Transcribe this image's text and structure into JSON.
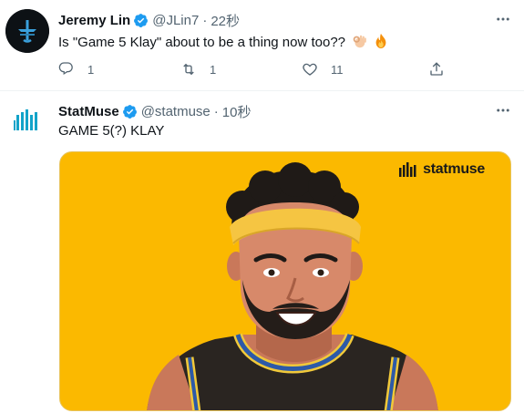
{
  "tweets": [
    {
      "name": "Jeremy Lin",
      "handle": "@JLin7",
      "separator": "·",
      "time": "22秒",
      "text": "Is \"Game 5 Klay\" about to be a thing now too??",
      "emojis": [
        "ok-hand-emoji",
        "fire-emoji"
      ],
      "actions": {
        "replies": "1",
        "retweets": "1",
        "likes": "11"
      }
    },
    {
      "name": "StatMuse",
      "handle": "@statmuse",
      "separator": "·",
      "time": "10秒",
      "text": "GAME 5(?) KLAY",
      "media": {
        "brand": "statmuse",
        "background": "#fbb900"
      }
    }
  ],
  "colors": {
    "verified": "#1d9bf0",
    "secondary": "#536471",
    "accent_yellow": "#fbb900"
  }
}
